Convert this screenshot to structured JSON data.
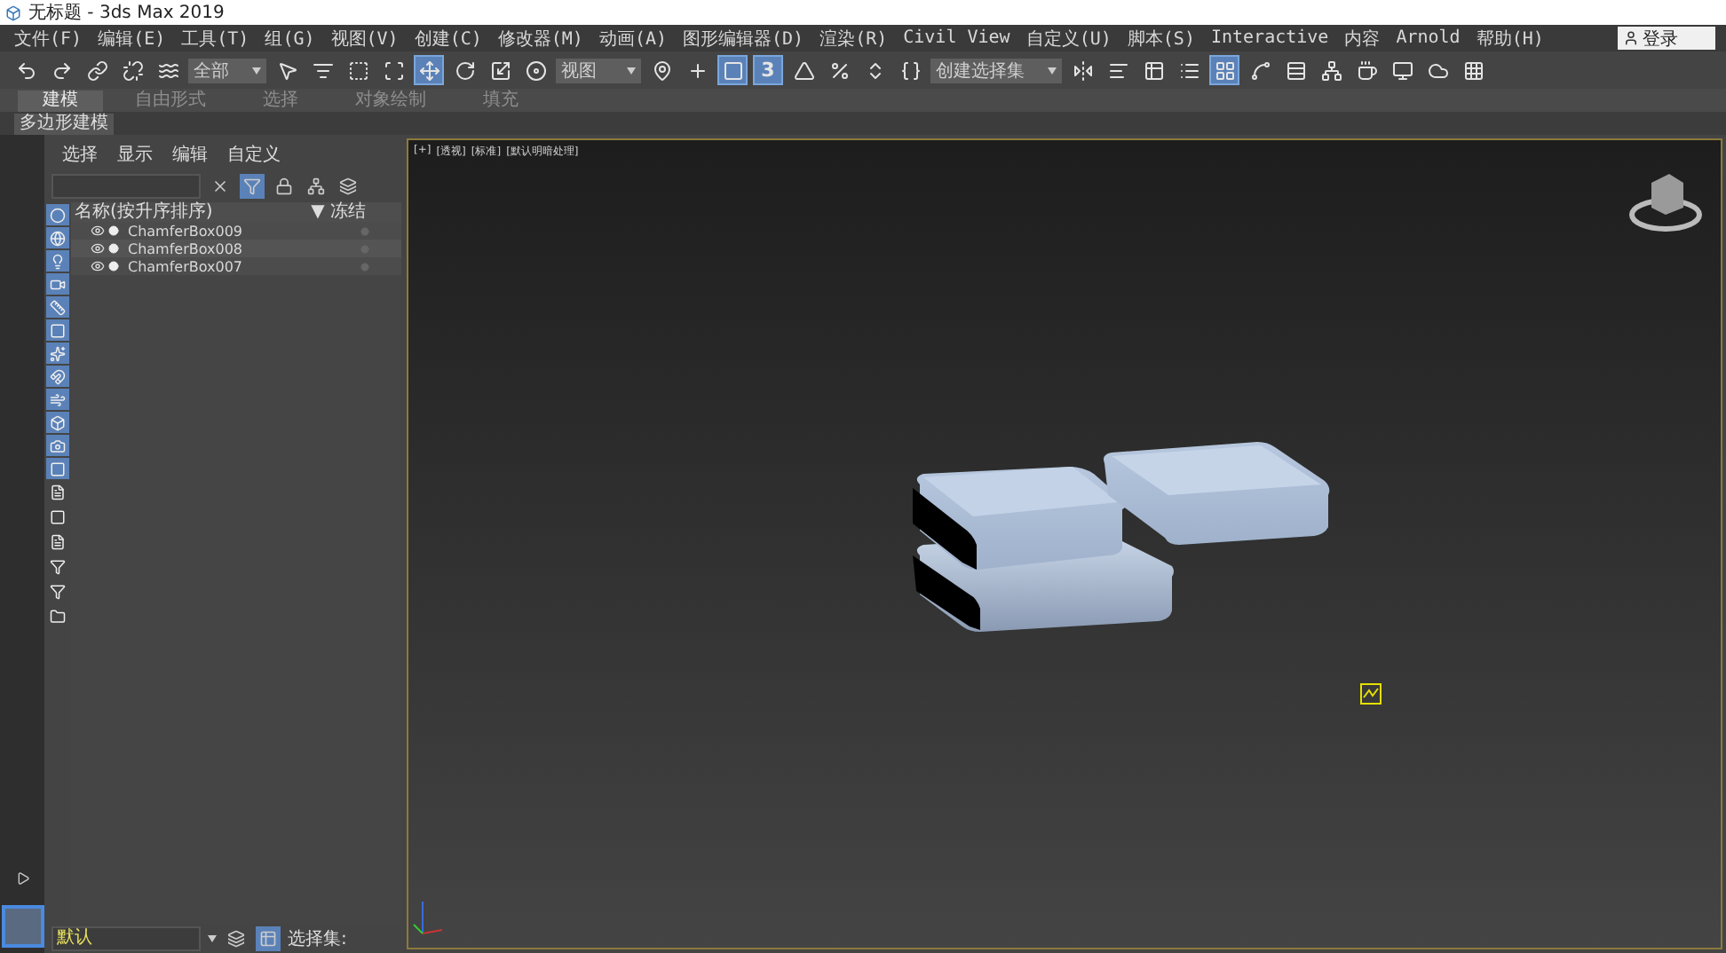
{
  "window": {
    "title": "无标题 - 3ds Max 2019"
  },
  "menu": [
    "文件(F)",
    "编辑(E)",
    "工具(T)",
    "组(G)",
    "视图(V)",
    "创建(C)",
    "修改器(M)",
    "动画(A)",
    "图形编辑器(D)",
    "渲染(R)",
    "Civil View",
    "自定义(U)",
    "脚本(S)",
    "Interactive",
    "内容",
    "Arnold",
    "帮助(H)"
  ],
  "account": {
    "label": "登录"
  },
  "toolbar": [
    {
      "kind": "icon",
      "selected": false
    },
    {
      "kind": "icon",
      "selected": false
    },
    {
      "kind": "icon",
      "selected": false
    },
    {
      "kind": "icon",
      "selected": false
    },
    {
      "kind": "icon",
      "selected": false
    },
    {
      "kind": "dropdown",
      "value": "全部"
    },
    {
      "kind": "icon",
      "selected": false
    },
    {
      "kind": "icon",
      "selected": false
    },
    {
      "kind": "icon",
      "selected": false
    },
    {
      "kind": "icon",
      "selected": false
    },
    {
      "kind": "icon",
      "selected": true
    },
    {
      "kind": "icon",
      "selected": false
    },
    {
      "kind": "icon",
      "selected": false
    },
    {
      "kind": "icon",
      "selected": false
    },
    {
      "kind": "dropdown",
      "value": "视图"
    },
    {
      "kind": "icon",
      "selected": false
    },
    {
      "kind": "icon",
      "selected": false
    },
    {
      "kind": "icon",
      "selected": true
    },
    {
      "kind": "label",
      "label": "3",
      "selected": true
    },
    {
      "kind": "icon",
      "selected": false
    },
    {
      "kind": "icon",
      "selected": false
    },
    {
      "kind": "icon",
      "selected": false
    },
    {
      "kind": "icon",
      "selected": false
    },
    {
      "kind": "dropdown",
      "value": "创建选择集"
    },
    {
      "kind": "icon",
      "selected": false
    },
    {
      "kind": "icon",
      "selected": false
    },
    {
      "kind": "icon",
      "selected": false
    },
    {
      "kind": "icon",
      "selected": false
    },
    {
      "kind": "icon",
      "selected": true
    },
    {
      "kind": "icon",
      "selected": false
    },
    {
      "kind": "icon",
      "selected": false
    },
    {
      "kind": "icon",
      "selected": false
    },
    {
      "kind": "icon",
      "selected": false
    },
    {
      "kind": "icon",
      "selected": false
    },
    {
      "kind": "icon",
      "selected": false
    },
    {
      "kind": "icon",
      "selected": false
    }
  ],
  "ribbon": {
    "tabs": [
      {
        "label": "建模",
        "selected": true
      },
      {
        "label": "自由形式",
        "selected": false
      },
      {
        "label": "选择",
        "selected": false
      },
      {
        "label": "对象绘制",
        "selected": false
      },
      {
        "label": "填充",
        "selected": false
      }
    ],
    "panel": "多边形建模"
  },
  "explorer": {
    "menu": [
      "选择",
      "显示",
      "编辑",
      "自定义"
    ],
    "filters": [
      {
        "selected": true
      },
      {
        "selected": true
      },
      {
        "selected": true
      },
      {
        "selected": true
      },
      {
        "selected": true
      },
      {
        "selected": true
      },
      {
        "selected": true
      },
      {
        "selected": true
      },
      {
        "selected": true
      },
      {
        "selected": true
      },
      {
        "selected": true
      },
      {
        "selected": true
      },
      {
        "selected": false
      },
      {
        "selected": false
      },
      {
        "selected": false
      },
      {
        "selected": false
      },
      {
        "selected": false
      },
      {
        "selected": false
      }
    ],
    "columns": [
      "名称(按升序排序)",
      "▼ 冻结"
    ],
    "rows": [
      {
        "name": "ChamferBox009"
      },
      {
        "name": "ChamferBox008"
      },
      {
        "name": "ChamferBox007"
      }
    ],
    "layer": {
      "value": "默认"
    },
    "selection_sets": "选择集:"
  },
  "viewport": {
    "labels": [
      "[+]",
      "[透视]",
      "[标准]",
      "[默认明暗处理]"
    ],
    "active": true
  }
}
